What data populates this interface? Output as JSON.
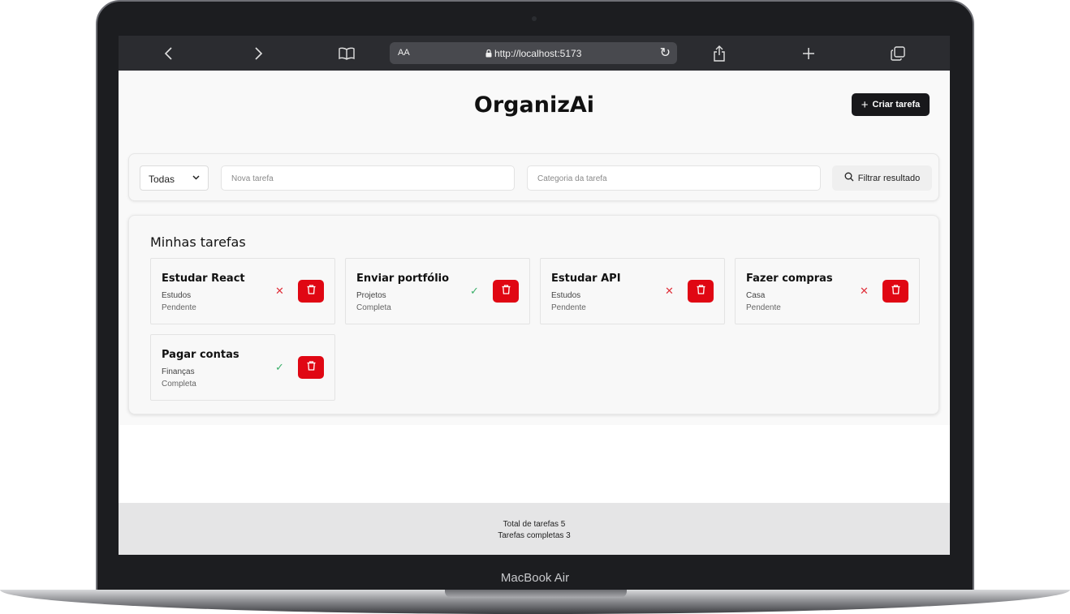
{
  "device": {
    "label": "MacBook Air"
  },
  "browser": {
    "url_text_size": "AA",
    "url": "http://localhost:5173",
    "icons": [
      "chevron-left-icon",
      "chevron-right-icon",
      "book-icon",
      "lock-icon",
      "reload-icon",
      "share-icon",
      "plus-icon",
      "tabs-icon"
    ]
  },
  "header": {
    "title": "OrganizAi",
    "create_button_label": "Criar tarefa"
  },
  "filters": {
    "status_selected": "Todas",
    "name_placeholder": "Nova tarefa",
    "category_placeholder": "Categoria da tarefa",
    "filter_button_label": "Filtrar resultado"
  },
  "tasks_section": {
    "heading": "Minhas tarefas",
    "tasks": [
      {
        "name": "Estudar React",
        "category": "Estudos",
        "status": "Pendente",
        "mark": "✕"
      },
      {
        "name": "Enviar portfólio",
        "category": "Projetos",
        "status": "Completa",
        "mark": "✓"
      },
      {
        "name": "Estudar API",
        "category": "Estudos",
        "status": "Pendente",
        "mark": "✕"
      },
      {
        "name": "Fazer compras",
        "category": "Casa",
        "status": "Pendente",
        "mark": "✕"
      },
      {
        "name": "Pagar contas",
        "category": "Finanças",
        "status": "Completa",
        "mark": "✓"
      }
    ]
  },
  "footer": {
    "total": "Total de tarefas 5",
    "completed": "Tarefas completas 3"
  },
  "colors": {
    "delete_button": "#e00713",
    "create_button": "#18181b",
    "pending_mark": "#e0313b",
    "complete_mark": "#3bb06a"
  }
}
